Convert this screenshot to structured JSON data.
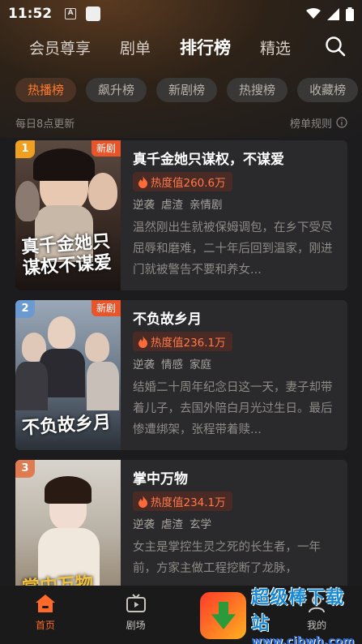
{
  "status_bar": {
    "time": "11:52",
    "notif_icon_a": "A"
  },
  "top_nav": {
    "tabs": [
      {
        "label": "会员尊享"
      },
      {
        "label": "剧单"
      },
      {
        "label": "排行榜"
      },
      {
        "label": "精选"
      }
    ],
    "active_tab": "排行榜"
  },
  "filter_chips": [
    {
      "label": "热播榜",
      "active": true
    },
    {
      "label": "飙升榜",
      "active": false
    },
    {
      "label": "新剧榜",
      "active": false
    },
    {
      "label": "热搜榜",
      "active": false
    },
    {
      "label": "收藏榜",
      "active": false
    }
  ],
  "subheader": {
    "update_note": "每日8点更新",
    "rules_label": "榜单规则"
  },
  "dramas": [
    {
      "rank": "1",
      "new_tag": "新剧",
      "title": "真千金她只谋权，不谋爱",
      "poster_title": "真千金她只谋权不谋爱",
      "heat": "热度值260.6万",
      "tags": [
        "逆袭",
        "虐渣",
        "亲情剧"
      ],
      "description": "温然刚出生就被保姆调包，在乡下受尽屈辱和磨难，二十年后回到温家，刚进门就被警告不要和养女..."
    },
    {
      "rank": "2",
      "new_tag": "新剧",
      "title": "不负故乡月",
      "poster_title": "不负故乡月",
      "heat": "热度值236.1万",
      "tags": [
        "逆袭",
        "情感",
        "家庭"
      ],
      "description": "结婚二十周年纪念日这一天，妻子却带着儿子，去国外陪白月光过生日。最后惨遭绑架，张程带着赎..."
    },
    {
      "rank": "3",
      "new_tag": "",
      "title": "掌中万物",
      "poster_title": "掌中万物",
      "heat": "热度值234.1万",
      "tags": [
        "逆袭",
        "虐渣",
        "玄学"
      ],
      "description": "女主是掌控生灵之死的长生者，一年前，方家主做工程挖断了龙脉，"
    }
  ],
  "bottom_nav": [
    {
      "label": "首页",
      "active": true
    },
    {
      "label": "剧场",
      "active": false
    },
    {
      "label": "",
      "active": false
    },
    {
      "label": "我的",
      "active": false
    }
  ],
  "watermark": {
    "text": "超级棒下载站",
    "url": "www.cjbwh.com"
  },
  "colors": {
    "accent": "#ff6a2a",
    "background": "#1c1c1e",
    "card": "#2a2a2c"
  }
}
